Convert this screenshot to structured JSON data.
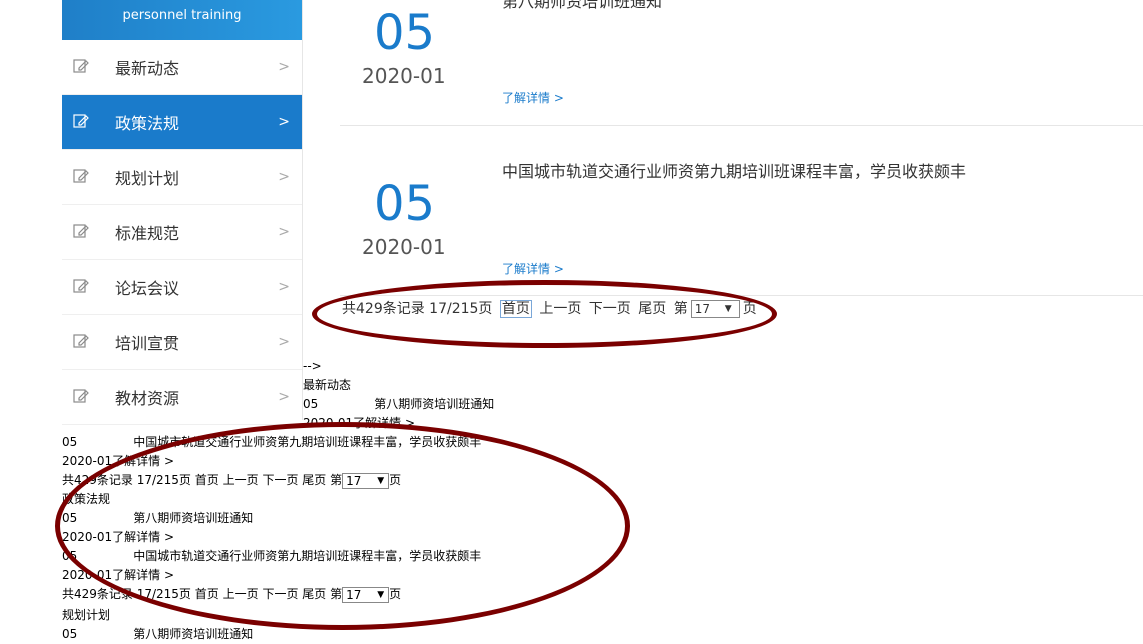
{
  "sidebar": {
    "header_text": "personnel training",
    "items": [
      {
        "label": "最新动态",
        "arrow": ">",
        "icon": "edit-icon",
        "active": false
      },
      {
        "label": "政策法规",
        "arrow": ">",
        "icon": "edit-icon",
        "active": true
      },
      {
        "label": "规划计划",
        "arrow": ">",
        "icon": "edit-icon",
        "active": false
      },
      {
        "label": "标准规范",
        "arrow": ">",
        "icon": "edit-icon",
        "active": false
      },
      {
        "label": "论坛会议",
        "arrow": ">",
        "icon": "edit-icon",
        "active": false
      },
      {
        "label": "培训宣贯",
        "arrow": ">",
        "icon": "edit-icon",
        "active": false
      },
      {
        "label": "教材资源",
        "arrow": ">",
        "icon": "edit-icon",
        "active": false
      }
    ]
  },
  "news": [
    {
      "day": "05",
      "ym": "2020-01",
      "title": "第八期师资培训班通知",
      "more": "了解详情 >"
    },
    {
      "day": "05",
      "ym": "2020-01",
      "title": "中国城市轨道交通行业师资第九期培训班课程丰富，学员收获颇丰",
      "more": "了解详情 >"
    }
  ],
  "pager": {
    "total": "共429条记录 17/215页",
    "first": "首页",
    "prev": "上一页",
    "next": "下一页",
    "last": "尾页",
    "page_prefix": "第",
    "page_value": "17",
    "page_suffix": "页"
  },
  "raw": {
    "comment": "-->",
    "section1": "最新动态",
    "section2": "政策法规",
    "section3": "规划计划",
    "item1_day": "05",
    "item1_title": "第八期师资培训班通知",
    "item1_more": "2020-01了解详情 >",
    "item2_day": "05",
    "item2_title": "中国城市轨道交通行业师资第九期培训班课程丰富，学员收获颇丰",
    "item2_more": "2020-01了解详情 >"
  },
  "colors": {
    "accent": "#1a7bcb",
    "annotation": "#7a0000"
  }
}
